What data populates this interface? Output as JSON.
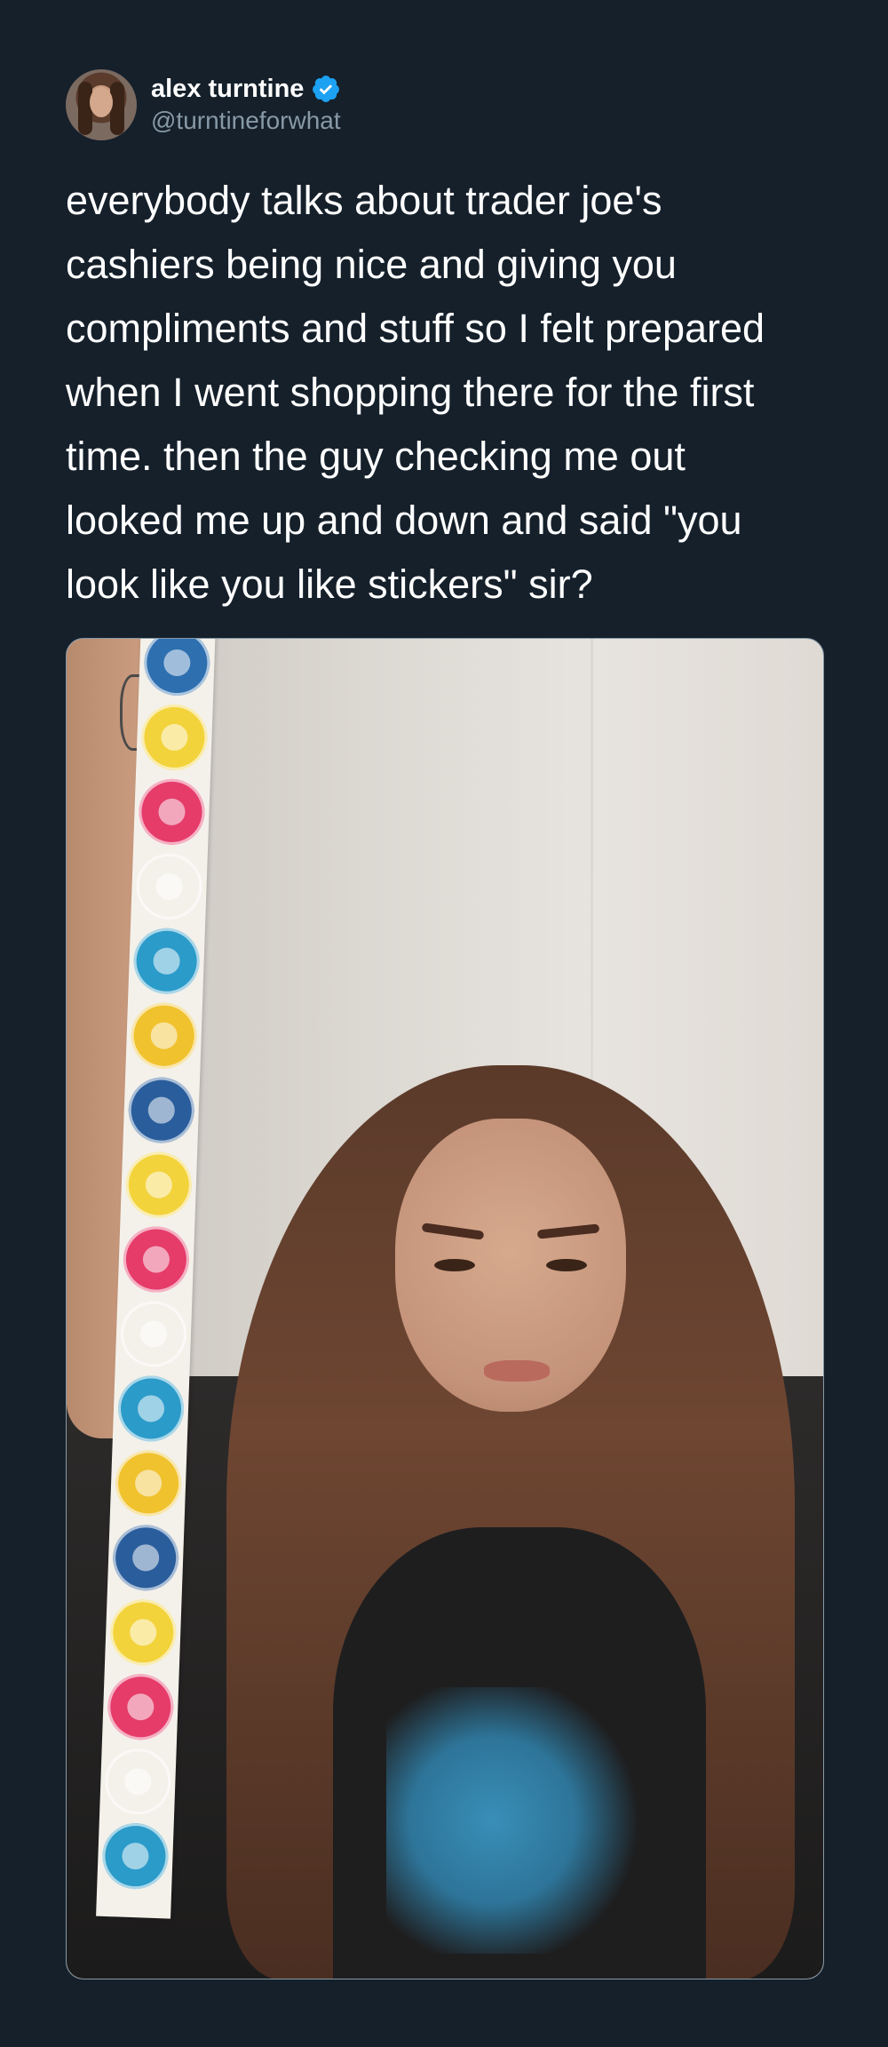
{
  "author": {
    "display_name": "alex turntine",
    "handle": "@turntineforwhat",
    "verified": true,
    "verified_icon": "verified-badge-icon"
  },
  "tweet": {
    "text": "everybody talks about trader joe's\ncashiers being nice and giving you\ncompliments and stuff so I felt prepared\nwhen I went shopping there for the first\ntime. then the guy checking me out\nlooked me up and down and said \"you\nlook like you like stickers\" sir?"
  },
  "colors": {
    "background": "#15202b",
    "text": "#ffffff",
    "secondary_text": "#8899a6",
    "verified_blue": "#1da1f2"
  },
  "media": {
    "type": "photo",
    "sticker_colors": [
      "#2e6fb0",
      "#f3d33b",
      "#e53c6a",
      "#f4f1ea",
      "#2b9bc9",
      "#f0c22e",
      "#2a5d9c",
      "#f3d33b",
      "#e53c6a",
      "#f4f1ea",
      "#2b9bc9",
      "#f0c22e",
      "#2a5d9c",
      "#f3d33b",
      "#e53c6a",
      "#f4f1ea",
      "#2b9bc9"
    ]
  }
}
